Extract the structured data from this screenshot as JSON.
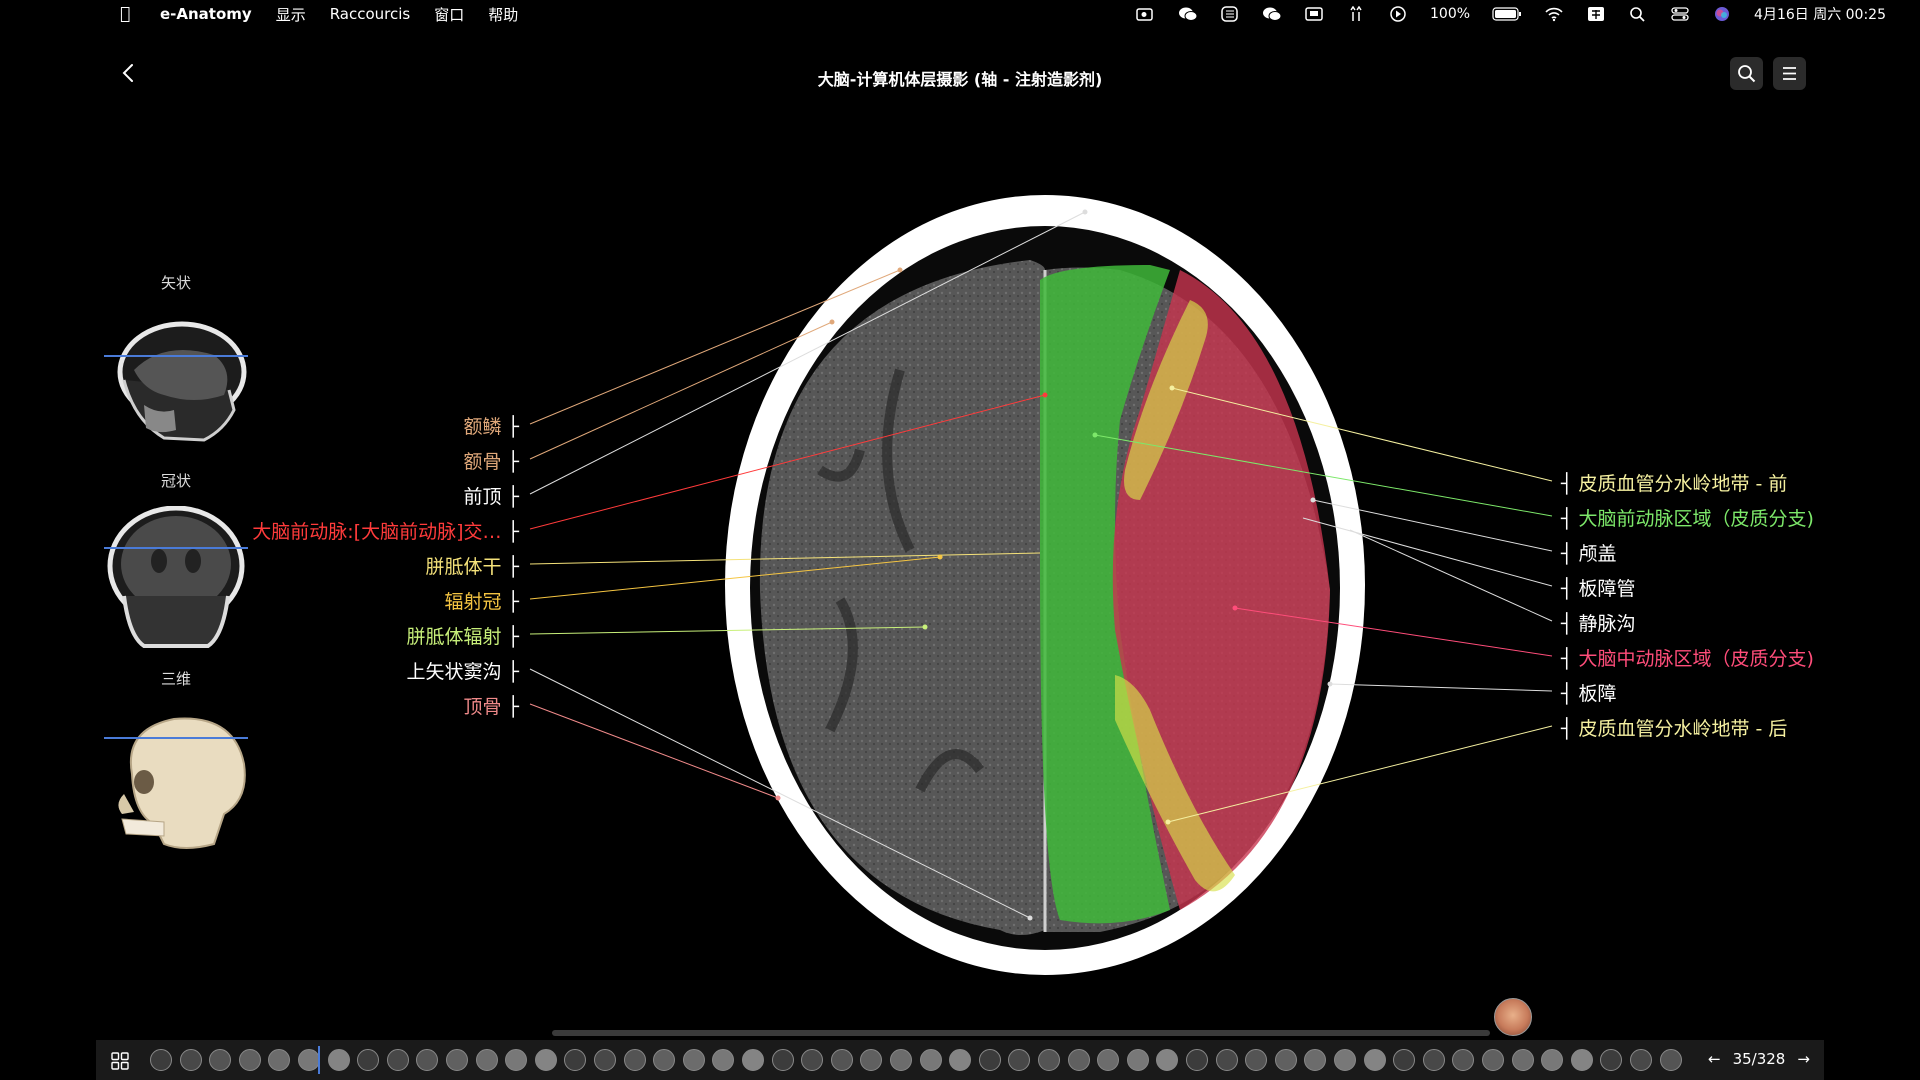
{
  "menubar": {
    "app_name": "e-Anatomy",
    "menus": [
      "显示",
      "Raccourcis",
      "窗口",
      "帮助"
    ],
    "battery": "100%",
    "datetime": "4月16日 周六 00:25"
  },
  "header": {
    "title": "大脑-计算机体层摄影 (轴 - 注射造影剂)"
  },
  "views": {
    "sagittal": "矢状",
    "coronal": "冠状",
    "three_d": "三维"
  },
  "labels_left": [
    {
      "text": "额鳞",
      "color": "#e0a87a"
    },
    {
      "text": "额骨",
      "color": "#e0a87a"
    },
    {
      "text": "前顶",
      "color": "#ffffff"
    },
    {
      "text": "大脑前动脉:[大脑前动脉]交…",
      "color": "#ff3b3b"
    },
    {
      "text": "胼胝体干",
      "color": "#f5e27a"
    },
    {
      "text": "辐射冠",
      "color": "#f5c542"
    },
    {
      "text": "胼胝体辐射",
      "color": "#c8f07a"
    },
    {
      "text": "上矢状窦沟",
      "color": "#ffffff"
    },
    {
      "text": "顶骨",
      "color": "#f08a8a"
    }
  ],
  "labels_right": [
    {
      "text": "皮质血管分水岭地带 - 前",
      "color": "#f5f0a0"
    },
    {
      "text": "大脑前动脉区域（皮质分支)",
      "color": "#7de86a"
    },
    {
      "text": "颅盖",
      "color": "#ffffff"
    },
    {
      "text": "板障管",
      "color": "#ffffff"
    },
    {
      "text": "静脉沟",
      "color": "#ffffff"
    },
    {
      "text": "大脑中动脉区域（皮质分支)",
      "color": "#ff4d7a"
    },
    {
      "text": "板障",
      "color": "#ffffff"
    },
    {
      "text": "皮质血管分水岭地带 - 后",
      "color": "#f5f0a0"
    }
  ],
  "navigation": {
    "page": "35/328"
  },
  "icons": {
    "apple": "apple-logo-icon",
    "back": "chevron-left-icon",
    "search": "search-icon",
    "menu": "hamburger-menu-icon",
    "grid": "grid-icon",
    "prev": "arrow-left-icon",
    "next": "arrow-right-icon"
  }
}
